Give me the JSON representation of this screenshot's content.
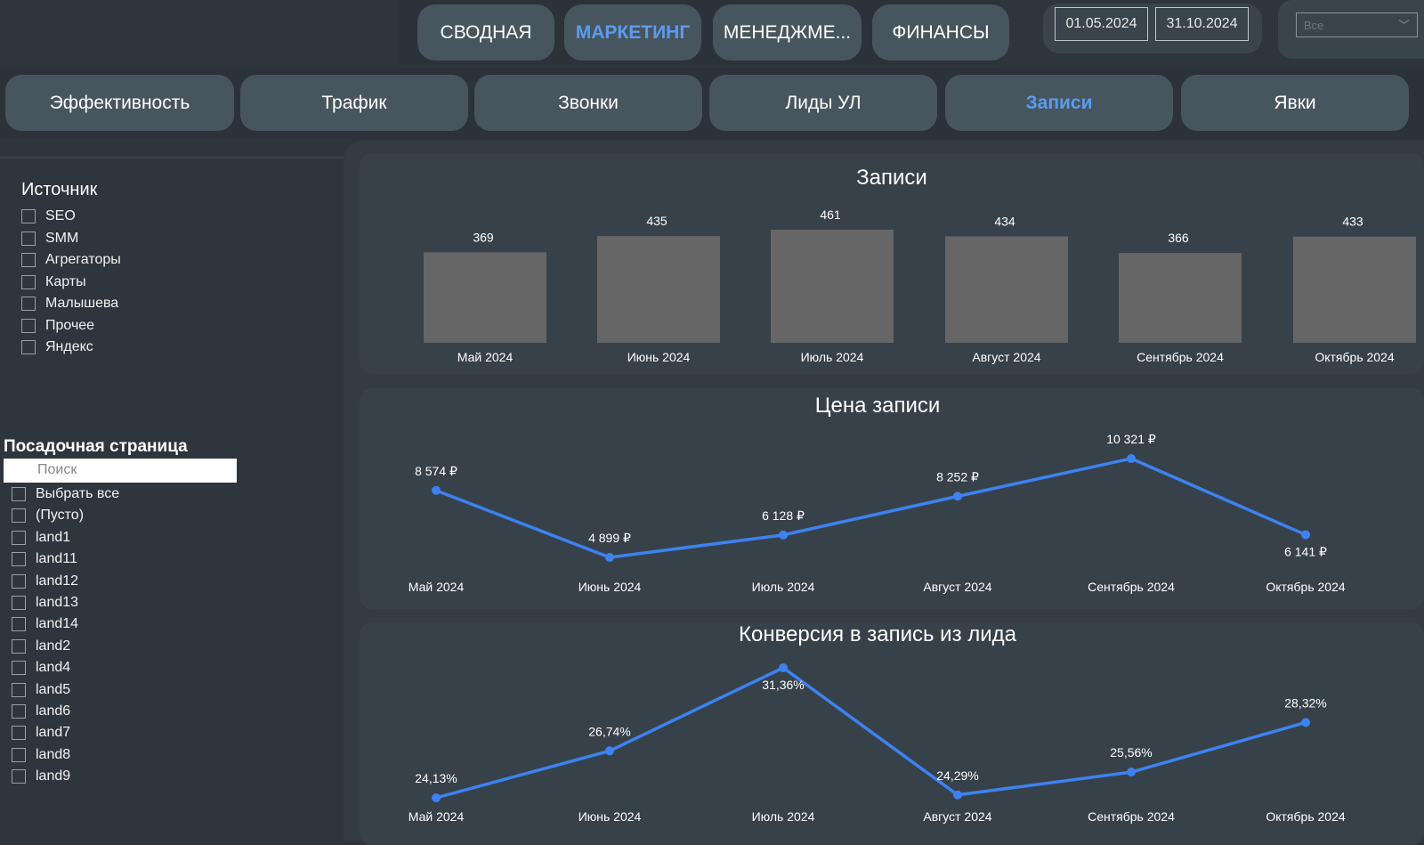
{
  "top_tabs": [
    {
      "label": "СВОДНАЯ"
    },
    {
      "label": "МАРКЕТИНГ",
      "active": true
    },
    {
      "label": "МЕНЕДЖМЕ..."
    },
    {
      "label": "ФИНАНСЫ"
    }
  ],
  "date_from": "01.05.2024",
  "date_to": "31.10.2024",
  "select": {
    "value": "Все",
    "icon": "chevron-down-icon"
  },
  "sub_tabs": [
    {
      "label": "Эффективность"
    },
    {
      "label": "Трафик"
    },
    {
      "label": "Звонки"
    },
    {
      "label": "Лиды УЛ"
    },
    {
      "label": "Записи",
      "active": true
    },
    {
      "label": "Явки"
    }
  ],
  "source_filter": {
    "title": "Источник",
    "items": [
      "SEO",
      "SMM",
      "Агрегаторы",
      "Карты",
      "Малышева",
      "Прочее",
      "Яндекс"
    ]
  },
  "landing_filter": {
    "title": "Посадочная страница",
    "search_placeholder": "Поиск",
    "items": [
      "Выбрать все",
      "(Пусто)",
      "land1",
      "land11",
      "land12",
      "land13",
      "land14",
      "land2",
      "land4",
      "land5",
      "land6",
      "land7",
      "land8",
      "land9"
    ]
  },
  "colors": {
    "accent": "#5b9cf0",
    "line": "#3d82f0",
    "bar": "#666666"
  },
  "chart_data": [
    {
      "type": "bar",
      "title": "Записи",
      "categories": [
        "Май 2024",
        "Июнь 2024",
        "Июль 2024",
        "Август 2024",
        "Сентябрь 2024",
        "Октябрь 2024"
      ],
      "values": [
        369,
        435,
        461,
        434,
        366,
        433
      ],
      "labels": [
        "369",
        "435",
        "461",
        "434",
        "366",
        "433"
      ]
    },
    {
      "type": "line",
      "title": "Цена записи",
      "categories": [
        "Май 2024",
        "Июнь 2024",
        "Июль 2024",
        "Август 2024",
        "Сентябрь 2024",
        "Октябрь 2024"
      ],
      "values": [
        8574,
        4899,
        6128,
        8252,
        10321,
        6141
      ],
      "labels": [
        "8 574 ₽",
        "4 899 ₽",
        "6 128 ₽",
        "8 252 ₽",
        "10 321 ₽",
        "6 141 ₽"
      ]
    },
    {
      "type": "line",
      "title": "Конверсия в запись из лида",
      "categories": [
        "Май 2024",
        "Июнь 2024",
        "Июль 2024",
        "Август 2024",
        "Сентябрь 2024",
        "Октябрь 2024"
      ],
      "values": [
        24.13,
        26.74,
        31.36,
        24.29,
        25.56,
        28.32
      ],
      "labels": [
        "24,13%",
        "26,74%",
        "31,36%",
        "24,29%",
        "25,56%",
        "28,32%"
      ]
    }
  ]
}
